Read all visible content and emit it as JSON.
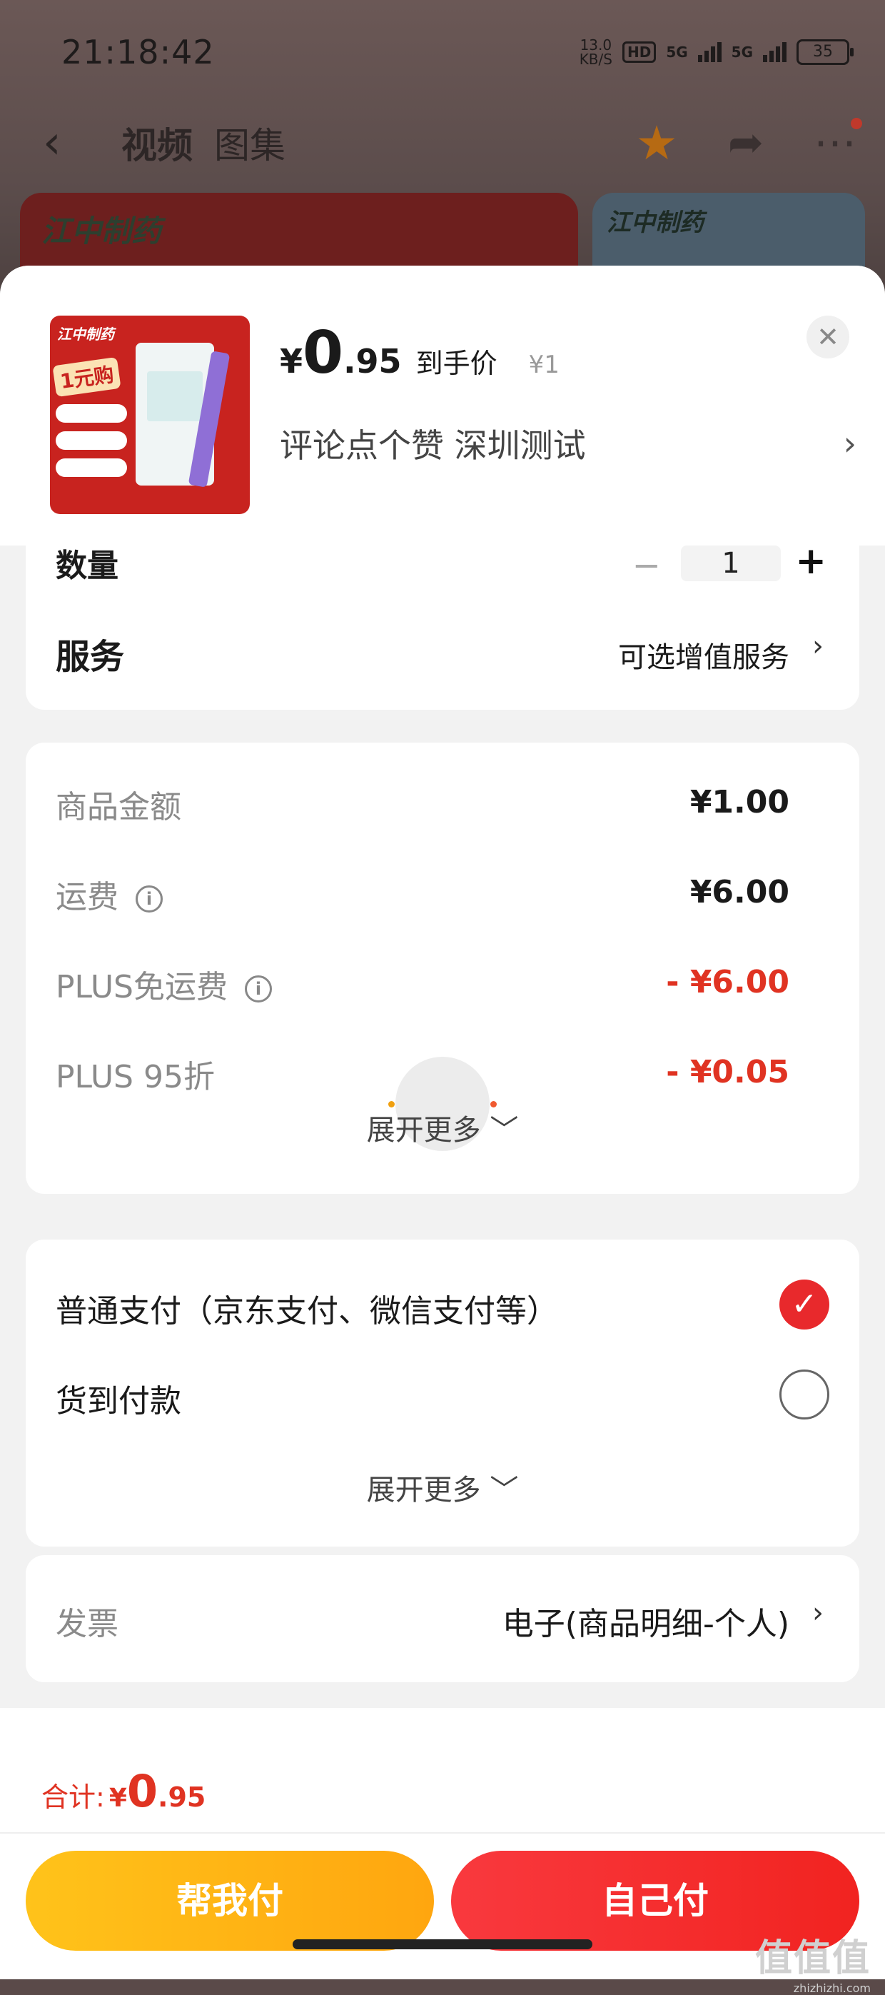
{
  "status_bar": {
    "time": "21:18:42",
    "net_speed_value": "13.0",
    "net_speed_unit": "KB/S",
    "hd_tag": "HD",
    "signal1": "5G",
    "signal2": "5G",
    "battery": "35"
  },
  "nav": {
    "back_icon": "‹",
    "tab_video": "视频",
    "tab_gallery": "图集",
    "star_icon": "★",
    "share_icon": "➦",
    "more_icon": "⋯"
  },
  "background": {
    "brand_text": "江中制药"
  },
  "product": {
    "brand": "江中制药",
    "promo": "1元购",
    "price_currency": "¥",
    "price_int": "0",
    "price_dec": ".95",
    "price_label": "到手价",
    "original_price": "¥1",
    "spec": "评论点个赞  深圳测试",
    "spec_chevron": "›",
    "close_icon": "✕"
  },
  "quantity": {
    "label": "数量",
    "minus": "−",
    "value": "1",
    "plus": "+"
  },
  "service": {
    "label": "服务",
    "value": "可选增值服务",
    "chevron": "›"
  },
  "costs": {
    "items": [
      {
        "label": "商品金额",
        "value": "¥1.00"
      },
      {
        "label": "运费",
        "value": "¥6.00"
      },
      {
        "label": "PLUS免运费",
        "value": "- ¥6.00"
      },
      {
        "label": "PLUS 95折",
        "value": "- ¥0.05"
      }
    ],
    "info_icon": "i",
    "expand": "展开更多 ﹀"
  },
  "payment": {
    "options": [
      {
        "label": "普通支付（京东支付、微信支付等）",
        "selected": true
      },
      {
        "label": "货到付款",
        "selected": false
      }
    ],
    "check_icon": "✓",
    "expand": "展开更多 ﹀"
  },
  "invoice": {
    "label": "发票",
    "value": "电子(商品明细-个人)",
    "chevron": "›"
  },
  "total": {
    "label": "合计:",
    "currency": "¥",
    "int": "0",
    "dec": ".95"
  },
  "buttons": {
    "help_pay": "帮我付",
    "self_pay": "自己付"
  },
  "watermark": {
    "text": "值值值",
    "url": "zhizhizhi.com"
  },
  "colors": {
    "accent_red": "#e03322",
    "button_yellow": "#ffb514",
    "button_red": "#f5302f"
  }
}
